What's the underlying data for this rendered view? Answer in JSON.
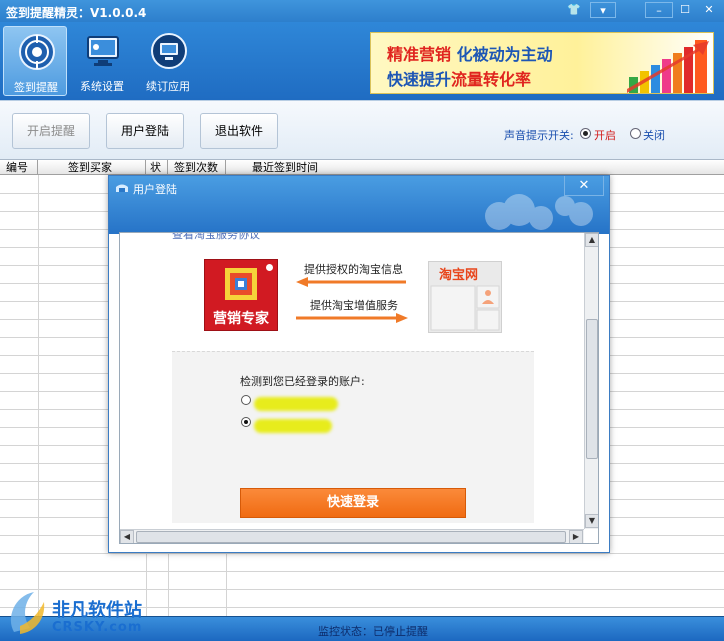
{
  "window": {
    "title": "签到提醒精灵：V1.0.0.4",
    "controls": {
      "skin": "👕",
      "menu": "▾",
      "minimize": "–",
      "maximize": "☐",
      "close": "✕"
    }
  },
  "toolbar": {
    "items": [
      {
        "label": "签到提醒",
        "icon": "shield-target-icon",
        "active": true
      },
      {
        "label": "系统设置",
        "icon": "monitor-settings-icon",
        "active": false
      },
      {
        "label": "续订应用",
        "icon": "monitor-circle-icon",
        "active": false
      }
    ],
    "banner": {
      "line1_a": "精准营销",
      "line1_b": " 化被动为主动",
      "line2_a": "快速提升",
      "line2_b": "流量转化率"
    }
  },
  "actions": {
    "start_reminder": "开启提醒",
    "user_login": "用户登陆",
    "exit_app": "退出软件",
    "sound_label": "声音提示开关:",
    "sound_on": "开启",
    "sound_off": "关闭",
    "sound_state": "on"
  },
  "grid": {
    "columns": [
      "编号",
      "签到买家",
      "状",
      "签到次数",
      "最近签到时间"
    ]
  },
  "dialog": {
    "title": "用户登陆",
    "close": "✕",
    "partial_text": "查看淘宝服务协议",
    "logo_text": "营销专家",
    "arrow_left_label": "提供授权的淘宝信息",
    "arrow_right_label": "提供淘宝增值服务",
    "taobao_text": "淘宝网",
    "detect_label": "检测到您已经登录的账户:",
    "accounts": [
      {
        "selected": false
      },
      {
        "selected": true
      }
    ],
    "login_button": "快速登录",
    "scroll_up": "▲",
    "scroll_down": "▼",
    "scroll_left": "◀",
    "scroll_right": "▶"
  },
  "status": {
    "text": "监控状态：已停止提醒"
  },
  "watermark": {
    "line1": "非凡软件站",
    "line2": "CRSKY.com"
  },
  "colors": {
    "title_bar": "#2d7fcc",
    "accent_red": "#d21b1b",
    "login_orange": "#f06b12"
  }
}
